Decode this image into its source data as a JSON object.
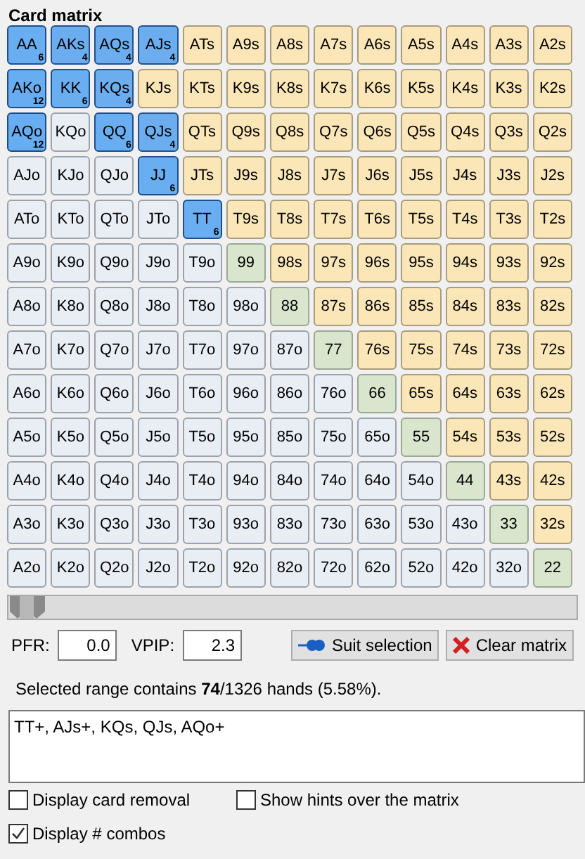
{
  "title": "Card matrix",
  "matrix": [
    [
      {
        "label": "AA",
        "kind": "pair",
        "selected": true,
        "combos": "6"
      },
      {
        "label": "AKs",
        "kind": "suited",
        "selected": true,
        "combos": "4"
      },
      {
        "label": "AQs",
        "kind": "suited",
        "selected": true,
        "combos": "4"
      },
      {
        "label": "AJs",
        "kind": "suited",
        "selected": true,
        "combos": "4"
      },
      {
        "label": "ATs",
        "kind": "suited",
        "selected": false
      },
      {
        "label": "A9s",
        "kind": "suited",
        "selected": false
      },
      {
        "label": "A8s",
        "kind": "suited",
        "selected": false
      },
      {
        "label": "A7s",
        "kind": "suited",
        "selected": false
      },
      {
        "label": "A6s",
        "kind": "suited",
        "selected": false
      },
      {
        "label": "A5s",
        "kind": "suited",
        "selected": false
      },
      {
        "label": "A4s",
        "kind": "suited",
        "selected": false
      },
      {
        "label": "A3s",
        "kind": "suited",
        "selected": false
      },
      {
        "label": "A2s",
        "kind": "suited",
        "selected": false
      }
    ],
    [
      {
        "label": "AKo",
        "kind": "offsuit",
        "selected": true,
        "combos": "12"
      },
      {
        "label": "KK",
        "kind": "pair",
        "selected": true,
        "combos": "6"
      },
      {
        "label": "KQs",
        "kind": "suited",
        "selected": true,
        "combos": "4"
      },
      {
        "label": "KJs",
        "kind": "suited",
        "selected": false
      },
      {
        "label": "KTs",
        "kind": "suited",
        "selected": false
      },
      {
        "label": "K9s",
        "kind": "suited",
        "selected": false
      },
      {
        "label": "K8s",
        "kind": "suited",
        "selected": false
      },
      {
        "label": "K7s",
        "kind": "suited",
        "selected": false
      },
      {
        "label": "K6s",
        "kind": "suited",
        "selected": false
      },
      {
        "label": "K5s",
        "kind": "suited",
        "selected": false
      },
      {
        "label": "K4s",
        "kind": "suited",
        "selected": false
      },
      {
        "label": "K3s",
        "kind": "suited",
        "selected": false
      },
      {
        "label": "K2s",
        "kind": "suited",
        "selected": false
      }
    ],
    [
      {
        "label": "AQo",
        "kind": "offsuit",
        "selected": true,
        "combos": "12"
      },
      {
        "label": "KQo",
        "kind": "offsuit",
        "selected": false
      },
      {
        "label": "QQ",
        "kind": "pair",
        "selected": true,
        "combos": "6"
      },
      {
        "label": "QJs",
        "kind": "suited",
        "selected": true,
        "combos": "4"
      },
      {
        "label": "QTs",
        "kind": "suited",
        "selected": false
      },
      {
        "label": "Q9s",
        "kind": "suited",
        "selected": false
      },
      {
        "label": "Q8s",
        "kind": "suited",
        "selected": false
      },
      {
        "label": "Q7s",
        "kind": "suited",
        "selected": false
      },
      {
        "label": "Q6s",
        "kind": "suited",
        "selected": false
      },
      {
        "label": "Q5s",
        "kind": "suited",
        "selected": false
      },
      {
        "label": "Q4s",
        "kind": "suited",
        "selected": false
      },
      {
        "label": "Q3s",
        "kind": "suited",
        "selected": false
      },
      {
        "label": "Q2s",
        "kind": "suited",
        "selected": false
      }
    ],
    [
      {
        "label": "AJo",
        "kind": "offsuit",
        "selected": false
      },
      {
        "label": "KJo",
        "kind": "offsuit",
        "selected": false
      },
      {
        "label": "QJo",
        "kind": "offsuit",
        "selected": false
      },
      {
        "label": "JJ",
        "kind": "pair",
        "selected": true,
        "combos": "6"
      },
      {
        "label": "JTs",
        "kind": "suited",
        "selected": false
      },
      {
        "label": "J9s",
        "kind": "suited",
        "selected": false
      },
      {
        "label": "J8s",
        "kind": "suited",
        "selected": false
      },
      {
        "label": "J7s",
        "kind": "suited",
        "selected": false
      },
      {
        "label": "J6s",
        "kind": "suited",
        "selected": false
      },
      {
        "label": "J5s",
        "kind": "suited",
        "selected": false
      },
      {
        "label": "J4s",
        "kind": "suited",
        "selected": false
      },
      {
        "label": "J3s",
        "kind": "suited",
        "selected": false
      },
      {
        "label": "J2s",
        "kind": "suited",
        "selected": false
      }
    ],
    [
      {
        "label": "ATo",
        "kind": "offsuit",
        "selected": false
      },
      {
        "label": "KTo",
        "kind": "offsuit",
        "selected": false
      },
      {
        "label": "QTo",
        "kind": "offsuit",
        "selected": false
      },
      {
        "label": "JTo",
        "kind": "offsuit",
        "selected": false
      },
      {
        "label": "TT",
        "kind": "pair",
        "selected": true,
        "combos": "6"
      },
      {
        "label": "T9s",
        "kind": "suited",
        "selected": false
      },
      {
        "label": "T8s",
        "kind": "suited",
        "selected": false
      },
      {
        "label": "T7s",
        "kind": "suited",
        "selected": false
      },
      {
        "label": "T6s",
        "kind": "suited",
        "selected": false
      },
      {
        "label": "T5s",
        "kind": "suited",
        "selected": false
      },
      {
        "label": "T4s",
        "kind": "suited",
        "selected": false
      },
      {
        "label": "T3s",
        "kind": "suited",
        "selected": false
      },
      {
        "label": "T2s",
        "kind": "suited",
        "selected": false
      }
    ],
    [
      {
        "label": "A9o",
        "kind": "offsuit",
        "selected": false
      },
      {
        "label": "K9o",
        "kind": "offsuit",
        "selected": false
      },
      {
        "label": "Q9o",
        "kind": "offsuit",
        "selected": false
      },
      {
        "label": "J9o",
        "kind": "offsuit",
        "selected": false
      },
      {
        "label": "T9o",
        "kind": "offsuit",
        "selected": false
      },
      {
        "label": "99",
        "kind": "pair",
        "selected": false
      },
      {
        "label": "98s",
        "kind": "suited",
        "selected": false
      },
      {
        "label": "97s",
        "kind": "suited",
        "selected": false
      },
      {
        "label": "96s",
        "kind": "suited",
        "selected": false
      },
      {
        "label": "95s",
        "kind": "suited",
        "selected": false
      },
      {
        "label": "94s",
        "kind": "suited",
        "selected": false
      },
      {
        "label": "93s",
        "kind": "suited",
        "selected": false
      },
      {
        "label": "92s",
        "kind": "suited",
        "selected": false
      }
    ],
    [
      {
        "label": "A8o",
        "kind": "offsuit",
        "selected": false
      },
      {
        "label": "K8o",
        "kind": "offsuit",
        "selected": false
      },
      {
        "label": "Q8o",
        "kind": "offsuit",
        "selected": false
      },
      {
        "label": "J8o",
        "kind": "offsuit",
        "selected": false
      },
      {
        "label": "T8o",
        "kind": "offsuit",
        "selected": false
      },
      {
        "label": "98o",
        "kind": "offsuit",
        "selected": false
      },
      {
        "label": "88",
        "kind": "pair",
        "selected": false
      },
      {
        "label": "87s",
        "kind": "suited",
        "selected": false
      },
      {
        "label": "86s",
        "kind": "suited",
        "selected": false
      },
      {
        "label": "85s",
        "kind": "suited",
        "selected": false
      },
      {
        "label": "84s",
        "kind": "suited",
        "selected": false
      },
      {
        "label": "83s",
        "kind": "suited",
        "selected": false
      },
      {
        "label": "82s",
        "kind": "suited",
        "selected": false
      }
    ],
    [
      {
        "label": "A7o",
        "kind": "offsuit",
        "selected": false
      },
      {
        "label": "K7o",
        "kind": "offsuit",
        "selected": false
      },
      {
        "label": "Q7o",
        "kind": "offsuit",
        "selected": false
      },
      {
        "label": "J7o",
        "kind": "offsuit",
        "selected": false
      },
      {
        "label": "T7o",
        "kind": "offsuit",
        "selected": false
      },
      {
        "label": "97o",
        "kind": "offsuit",
        "selected": false
      },
      {
        "label": "87o",
        "kind": "offsuit",
        "selected": false
      },
      {
        "label": "77",
        "kind": "pair",
        "selected": false
      },
      {
        "label": "76s",
        "kind": "suited",
        "selected": false
      },
      {
        "label": "75s",
        "kind": "suited",
        "selected": false
      },
      {
        "label": "74s",
        "kind": "suited",
        "selected": false
      },
      {
        "label": "73s",
        "kind": "suited",
        "selected": false
      },
      {
        "label": "72s",
        "kind": "suited",
        "selected": false
      }
    ],
    [
      {
        "label": "A6o",
        "kind": "offsuit",
        "selected": false
      },
      {
        "label": "K6o",
        "kind": "offsuit",
        "selected": false
      },
      {
        "label": "Q6o",
        "kind": "offsuit",
        "selected": false
      },
      {
        "label": "J6o",
        "kind": "offsuit",
        "selected": false
      },
      {
        "label": "T6o",
        "kind": "offsuit",
        "selected": false
      },
      {
        "label": "96o",
        "kind": "offsuit",
        "selected": false
      },
      {
        "label": "86o",
        "kind": "offsuit",
        "selected": false
      },
      {
        "label": "76o",
        "kind": "offsuit",
        "selected": false
      },
      {
        "label": "66",
        "kind": "pair",
        "selected": false
      },
      {
        "label": "65s",
        "kind": "suited",
        "selected": false
      },
      {
        "label": "64s",
        "kind": "suited",
        "selected": false
      },
      {
        "label": "63s",
        "kind": "suited",
        "selected": false
      },
      {
        "label": "62s",
        "kind": "suited",
        "selected": false
      }
    ],
    [
      {
        "label": "A5o",
        "kind": "offsuit",
        "selected": false
      },
      {
        "label": "K5o",
        "kind": "offsuit",
        "selected": false
      },
      {
        "label": "Q5o",
        "kind": "offsuit",
        "selected": false
      },
      {
        "label": "J5o",
        "kind": "offsuit",
        "selected": false
      },
      {
        "label": "T5o",
        "kind": "offsuit",
        "selected": false
      },
      {
        "label": "95o",
        "kind": "offsuit",
        "selected": false
      },
      {
        "label": "85o",
        "kind": "offsuit",
        "selected": false
      },
      {
        "label": "75o",
        "kind": "offsuit",
        "selected": false
      },
      {
        "label": "65o",
        "kind": "offsuit",
        "selected": false
      },
      {
        "label": "55",
        "kind": "pair",
        "selected": false
      },
      {
        "label": "54s",
        "kind": "suited",
        "selected": false
      },
      {
        "label": "53s",
        "kind": "suited",
        "selected": false
      },
      {
        "label": "52s",
        "kind": "suited",
        "selected": false
      }
    ],
    [
      {
        "label": "A4o",
        "kind": "offsuit",
        "selected": false
      },
      {
        "label": "K4o",
        "kind": "offsuit",
        "selected": false
      },
      {
        "label": "Q4o",
        "kind": "offsuit",
        "selected": false
      },
      {
        "label": "J4o",
        "kind": "offsuit",
        "selected": false
      },
      {
        "label": "T4o",
        "kind": "offsuit",
        "selected": false
      },
      {
        "label": "94o",
        "kind": "offsuit",
        "selected": false
      },
      {
        "label": "84o",
        "kind": "offsuit",
        "selected": false
      },
      {
        "label": "74o",
        "kind": "offsuit",
        "selected": false
      },
      {
        "label": "64o",
        "kind": "offsuit",
        "selected": false
      },
      {
        "label": "54o",
        "kind": "offsuit",
        "selected": false
      },
      {
        "label": "44",
        "kind": "pair",
        "selected": false
      },
      {
        "label": "43s",
        "kind": "suited",
        "selected": false
      },
      {
        "label": "42s",
        "kind": "suited",
        "selected": false
      }
    ],
    [
      {
        "label": "A3o",
        "kind": "offsuit",
        "selected": false
      },
      {
        "label": "K3o",
        "kind": "offsuit",
        "selected": false
      },
      {
        "label": "Q3o",
        "kind": "offsuit",
        "selected": false
      },
      {
        "label": "J3o",
        "kind": "offsuit",
        "selected": false
      },
      {
        "label": "T3o",
        "kind": "offsuit",
        "selected": false
      },
      {
        "label": "93o",
        "kind": "offsuit",
        "selected": false
      },
      {
        "label": "83o",
        "kind": "offsuit",
        "selected": false
      },
      {
        "label": "73o",
        "kind": "offsuit",
        "selected": false
      },
      {
        "label": "63o",
        "kind": "offsuit",
        "selected": false
      },
      {
        "label": "53o",
        "kind": "offsuit",
        "selected": false
      },
      {
        "label": "43o",
        "kind": "offsuit",
        "selected": false
      },
      {
        "label": "33",
        "kind": "pair",
        "selected": false
      },
      {
        "label": "32s",
        "kind": "suited",
        "selected": false
      }
    ],
    [
      {
        "label": "A2o",
        "kind": "offsuit",
        "selected": false
      },
      {
        "label": "K2o",
        "kind": "offsuit",
        "selected": false
      },
      {
        "label": "Q2o",
        "kind": "offsuit",
        "selected": false
      },
      {
        "label": "J2o",
        "kind": "offsuit",
        "selected": false
      },
      {
        "label": "T2o",
        "kind": "offsuit",
        "selected": false
      },
      {
        "label": "92o",
        "kind": "offsuit",
        "selected": false
      },
      {
        "label": "82o",
        "kind": "offsuit",
        "selected": false
      },
      {
        "label": "72o",
        "kind": "offsuit",
        "selected": false
      },
      {
        "label": "62o",
        "kind": "offsuit",
        "selected": false
      },
      {
        "label": "52o",
        "kind": "offsuit",
        "selected": false
      },
      {
        "label": "42o",
        "kind": "offsuit",
        "selected": false
      },
      {
        "label": "32o",
        "kind": "offsuit",
        "selected": false
      },
      {
        "label": "22",
        "kind": "pair",
        "selected": false
      }
    ]
  ],
  "slider": {
    "level": 0
  },
  "stats": [
    {
      "label": "PFR:",
      "value": "0.0"
    },
    {
      "label": "VPIP:",
      "value": "2.3"
    }
  ],
  "buttons": [
    {
      "label": "Suit selection",
      "kind": "suit"
    },
    {
      "label": "Clear matrix",
      "kind": "clear"
    }
  ],
  "summary": "Selected range contains **74**/1326 hands (5.58%).",
  "range_text": "TT+, AJs+, KQs, QJs, AQo+",
  "options": [
    {
      "label": "Display card removal",
      "checked": false
    },
    {
      "label": "Show hints over the matrix",
      "checked": false
    },
    {
      "label": "Display # combos",
      "checked": true
    }
  ]
}
